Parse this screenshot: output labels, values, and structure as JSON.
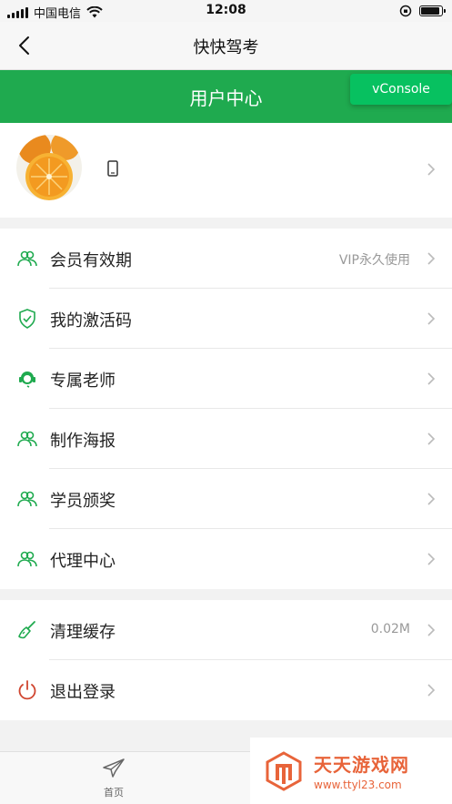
{
  "status_bar": {
    "carrier": "中国电信",
    "time": "12:08",
    "battery_level": 0.9,
    "icons": [
      "signal-icon",
      "wifi-icon",
      "orientation-lock-icon",
      "battery-icon"
    ]
  },
  "nav": {
    "title": "快快驾考",
    "back_icon": "chevron-left-icon"
  },
  "header": {
    "title": "用户中心",
    "color": "#1faa4f"
  },
  "vconsole": {
    "label": "vConsole",
    "color": "#07c160"
  },
  "profile": {
    "avatar": "orange-avatar",
    "phone_icon": "phone-icon"
  },
  "menu_group_1": [
    {
      "label": "会员有效期",
      "value": "VIP永久使用",
      "icon": "users-icon"
    },
    {
      "label": "我的激活码",
      "value": "",
      "icon": "shield-check-icon"
    },
    {
      "label": "专属老师",
      "value": "",
      "icon": "headset-icon"
    },
    {
      "label": "制作海报",
      "value": "",
      "icon": "users-icon"
    },
    {
      "label": "学员颁奖",
      "value": "",
      "icon": "users-icon"
    },
    {
      "label": "代理中心",
      "value": "",
      "icon": "users-icon"
    }
  ],
  "menu_group_2": [
    {
      "label": "清理缓存",
      "value": "0.02M",
      "icon": "broom-icon"
    },
    {
      "label": "退出登录",
      "value": "",
      "icon": "power-icon"
    }
  ],
  "tabbar": {
    "home_label": "首页",
    "home_icon": "paper-plane-icon"
  },
  "watermark": {
    "title": "天天游戏网",
    "url": "www.ttyl23.com"
  }
}
